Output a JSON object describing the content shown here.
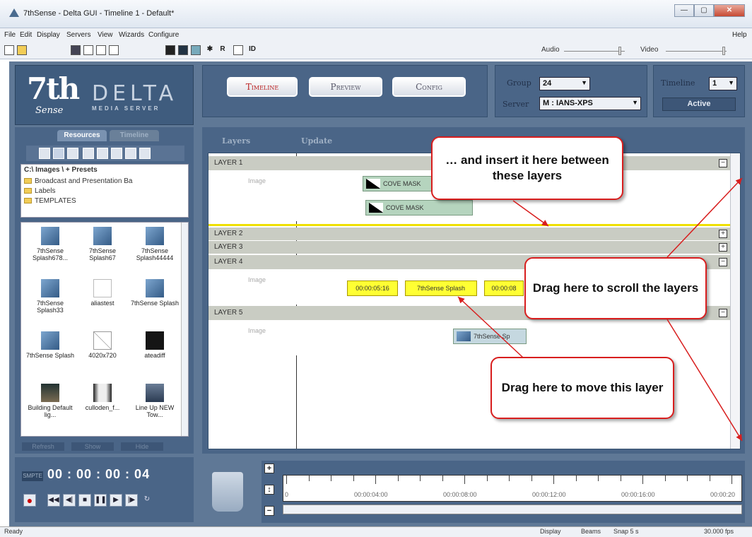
{
  "window": {
    "title": "7thSense - Delta GUI - Timeline 1 - Default*",
    "minimize": "—",
    "maximize": "▢",
    "close": "✕"
  },
  "menu": {
    "items": [
      "File",
      "Edit",
      "Display",
      "Servers",
      "View",
      "Wizards",
      "Configure"
    ],
    "help": "Help"
  },
  "toolbar": {
    "icons": [
      "new-icon",
      "open-icon",
      "save-icon",
      "properties-icon",
      "grid-icon",
      "layout-icon",
      "display-black-icon",
      "display-dark-icon",
      "image-icon",
      "star-icon"
    ],
    "r_label": "R",
    "id_label": "ID",
    "audio_label": "Audio",
    "video_label": "Video",
    "audio_level": 0.92,
    "video_level": 0.95
  },
  "logo": {
    "main": "7th",
    "sub": "Sense",
    "delta": "DELTA",
    "tagline": "MEDIA SERVER"
  },
  "modes": {
    "timeline": "Timeline",
    "preview": "Preview",
    "config": "Config",
    "active": "timeline"
  },
  "group_panel": {
    "group_label": "Group",
    "group_value": "24",
    "server_label": "Server",
    "server_value": "M : IANS-XPS"
  },
  "timeline_panel": {
    "label": "Timeline",
    "value": "1",
    "status": "Active"
  },
  "resources": {
    "tabs": [
      "Resources",
      "Timeline"
    ],
    "active_tab": "Resources",
    "path": "C:\\ Images \\ + Presets",
    "folders": [
      "Broadcast and Presentation Ba",
      "Labels",
      "TEMPLATES"
    ],
    "thumbs": [
      {
        "name": "7thSense Splash678...",
        "kind": "splash"
      },
      {
        "name": "7thSense Splash67",
        "kind": "splash"
      },
      {
        "name": "7thSense Splash44444",
        "kind": "splash"
      },
      {
        "name": "7thSense Splash33",
        "kind": "splash"
      },
      {
        "name": "aliastest",
        "kind": "alias"
      },
      {
        "name": "7thSense Splash",
        "kind": "splash"
      },
      {
        "name": "7thSense Splash",
        "kind": "splash"
      },
      {
        "name": "4020x720",
        "kind": "blank"
      },
      {
        "name": "ateadiff",
        "kind": "dark"
      },
      {
        "name": "Building Default lig...",
        "kind": "city"
      },
      {
        "name": "culloden_f...",
        "kind": "culloden"
      },
      {
        "name": "Line Up NEW Tow...",
        "kind": "lineup"
      }
    ],
    "buttons": [
      "Refresh",
      "Show",
      "Hide"
    ]
  },
  "timeline": {
    "tabs": [
      "Layers",
      "Update"
    ],
    "layers": [
      {
        "name": "LAYER 1",
        "expanded": true,
        "type": "Image"
      },
      {
        "name": "LAYER 2",
        "expanded": false
      },
      {
        "name": "LAYER 3",
        "expanded": false
      },
      {
        "name": "LAYER 4",
        "expanded": true,
        "type": "Image"
      },
      {
        "name": "LAYER 5",
        "expanded": true,
        "type": "Image"
      }
    ],
    "clips": {
      "cove1": "COVE MASK",
      "cove2": "COVE MASK",
      "mark1": "00:00:05:16",
      "splash": "7thSense Splash",
      "mark2": "00:00:08",
      "splash5": "7thSense Sp"
    },
    "collapse_icon": "−",
    "expand_icon": "+"
  },
  "callouts": {
    "insert": "… and insert it  here between these layers",
    "scroll": "Drag here to scroll the layers",
    "move": "Drag here to move this layer"
  },
  "transport": {
    "smpte_label": "SMPTE",
    "time": "00 : 00 : 00 : 04"
  },
  "ruler": {
    "labels": [
      "0",
      "00:00:04:00",
      "00:00:08:00",
      "00:00:12:00",
      "00:00:16:00",
      "00:00:20"
    ]
  },
  "status": {
    "ready": "Ready",
    "display": "Display",
    "beams": "Beams",
    "snap": "Snap 5 s",
    "fps": "30.000 fps"
  }
}
